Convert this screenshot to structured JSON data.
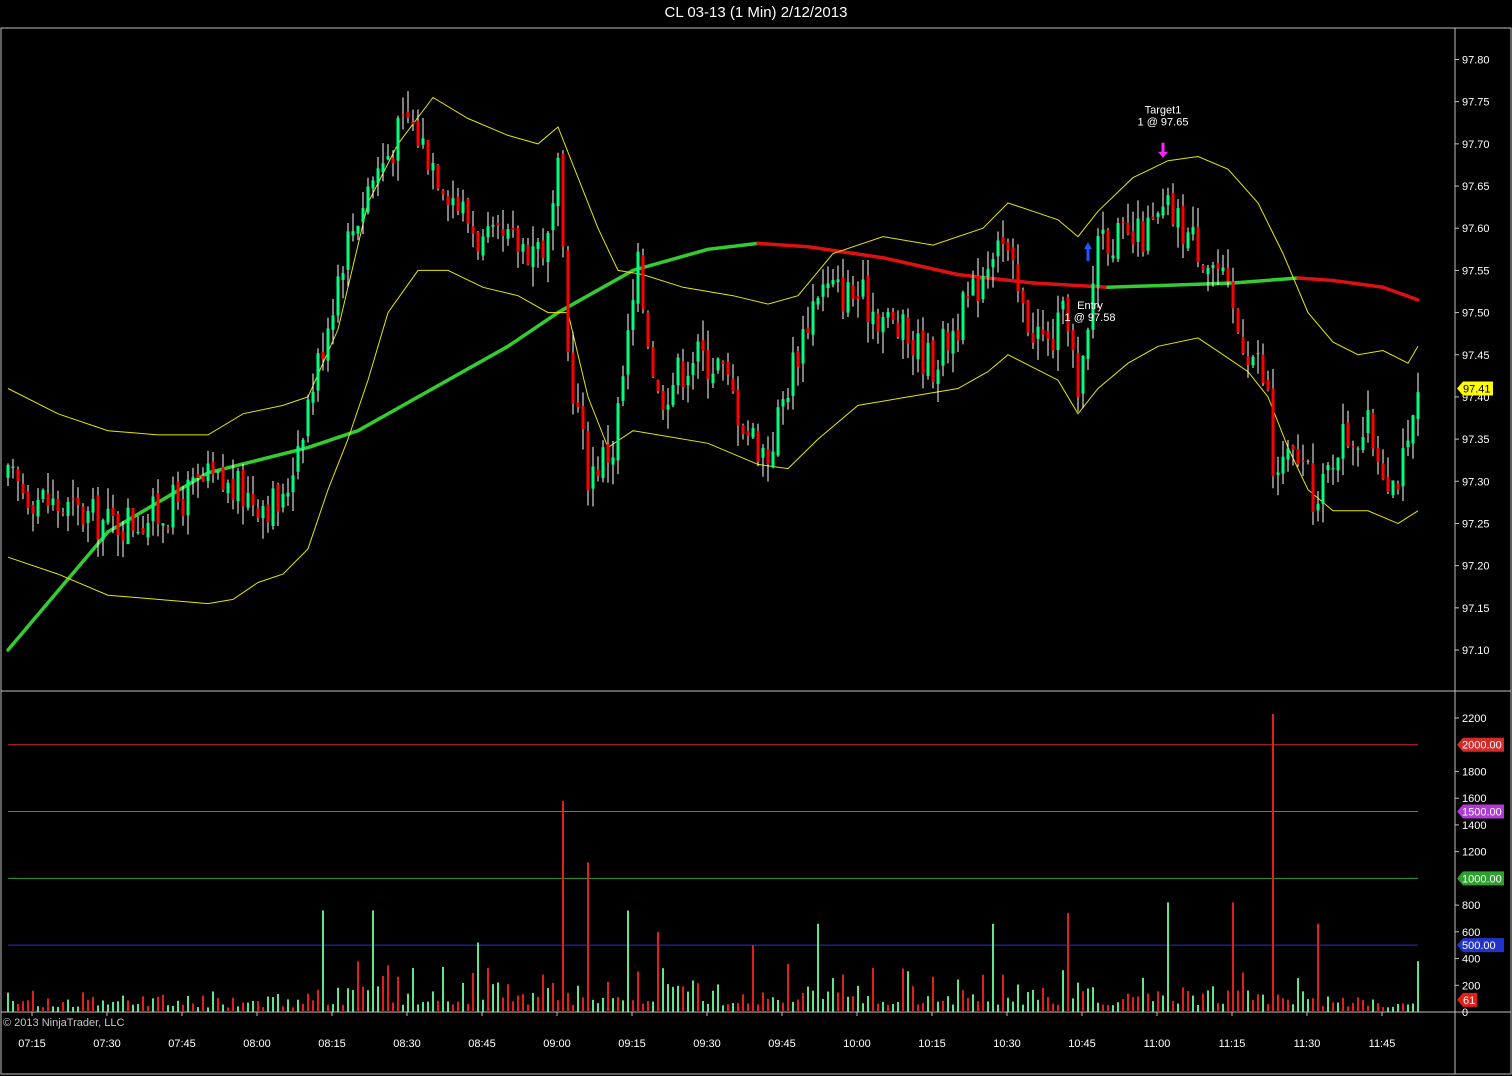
{
  "window": {
    "title": "CL 03-13 (1 Min)  2/12/2013"
  },
  "footer": {
    "copyright": "© 2013 NinjaTrader, LLC"
  },
  "colors": {
    "background": "#000000",
    "up_candle": "#00ff7f",
    "down_candle": "#ff0000",
    "wick": "#ffffff",
    "bollinger": "#e6e600",
    "ma_rising": "#33cc33",
    "ma_falling": "#dd1111",
    "volume_up": "#5fe68a",
    "volume_down": "#e0201a",
    "grid_border": "#c0c0c0"
  },
  "chart_data": [
    {
      "type": "candlestick",
      "panel": "price",
      "instrument": "CL 03-13",
      "interval": "1 Min",
      "date": "2/12/2013",
      "x_ticks": [
        "07:15",
        "07:30",
        "07:45",
        "08:00",
        "08:15",
        "08:30",
        "08:45",
        "09:00",
        "09:15",
        "09:30",
        "09:45",
        "10:00",
        "10:15",
        "10:30",
        "10:45",
        "11:00",
        "11:15",
        "11:30",
        "11:45"
      ],
      "y_ticks": [
        97.8,
        97.75,
        97.7,
        97.65,
        97.6,
        97.55,
        97.5,
        97.45,
        97.4,
        97.35,
        97.3,
        97.25,
        97.2,
        97.15,
        97.1
      ],
      "ylim": [
        97.05,
        97.83
      ],
      "last_price": "97.41",
      "anchors": [
        {
          "t": 0,
          "p": 97.3
        },
        {
          "t": 10,
          "p": 97.27
        },
        {
          "t": 20,
          "p": 97.25
        },
        {
          "t": 30,
          "p": 97.26
        },
        {
          "t": 40,
          "p": 97.3
        },
        {
          "t": 50,
          "p": 97.28
        },
        {
          "t": 55,
          "p": 97.27
        },
        {
          "t": 58,
          "p": 97.35
        },
        {
          "t": 62,
          "p": 97.44
        },
        {
          "t": 67,
          "p": 97.57
        },
        {
          "t": 72,
          "p": 97.65
        },
        {
          "t": 80,
          "p": 97.73
        },
        {
          "t": 88,
          "p": 97.65
        },
        {
          "t": 95,
          "p": 97.58
        },
        {
          "t": 103,
          "p": 97.58
        },
        {
          "t": 108,
          "p": 97.58
        },
        {
          "t": 110,
          "p": 97.66
        },
        {
          "t": 112,
          "p": 97.45
        },
        {
          "t": 116,
          "p": 97.31
        },
        {
          "t": 121,
          "p": 97.34
        },
        {
          "t": 126,
          "p": 97.55
        },
        {
          "t": 130,
          "p": 97.4
        },
        {
          "t": 137,
          "p": 97.45
        },
        {
          "t": 142,
          "p": 97.44
        },
        {
          "t": 148,
          "p": 97.36
        },
        {
          "t": 152,
          "p": 97.33
        },
        {
          "t": 157,
          "p": 97.44
        },
        {
          "t": 162,
          "p": 97.53
        },
        {
          "t": 170,
          "p": 97.52
        },
        {
          "t": 178,
          "p": 97.48
        },
        {
          "t": 185,
          "p": 97.44
        },
        {
          "t": 193,
          "p": 97.52
        },
        {
          "t": 198,
          "p": 97.6
        },
        {
          "t": 203,
          "p": 97.5
        },
        {
          "t": 208,
          "p": 97.46
        },
        {
          "t": 212,
          "p": 97.5
        },
        {
          "t": 214,
          "p": 97.39
        },
        {
          "t": 216,
          "p": 97.47
        },
        {
          "t": 218,
          "p": 97.6
        },
        {
          "t": 224,
          "p": 97.58
        },
        {
          "t": 229,
          "p": 97.6
        },
        {
          "t": 232,
          "p": 97.62
        },
        {
          "t": 238,
          "p": 97.58
        },
        {
          "t": 242,
          "p": 97.55
        },
        {
          "t": 246,
          "p": 97.48
        },
        {
          "t": 250,
          "p": 97.44
        },
        {
          "t": 252,
          "p": 97.4
        },
        {
          "t": 253,
          "p": 97.31
        },
        {
          "t": 258,
          "p": 97.33
        },
        {
          "t": 262,
          "p": 97.27
        },
        {
          "t": 266,
          "p": 97.35
        },
        {
          "t": 272,
          "p": 97.36
        },
        {
          "t": 277,
          "p": 97.3
        },
        {
          "t": 280,
          "p": 97.33
        },
        {
          "t": 282,
          "p": 97.4
        }
      ],
      "series": [
        {
          "name": "",
          "kind": "sma_slow",
          "points": [
            {
              "t": 0,
              "p": 97.1
            },
            {
              "t": 20,
              "p": 97.24
            },
            {
              "t": 40,
              "p": 97.31
            },
            {
              "t": 60,
              "p": 97.34
            },
            {
              "t": 70,
              "p": 97.36
            },
            {
              "t": 85,
              "p": 97.41
            },
            {
              "t": 100,
              "p": 97.46
            },
            {
              "t": 110,
              "p": 97.5
            },
            {
              "t": 125,
              "p": 97.55
            },
            {
              "t": 140,
              "p": 97.575
            },
            {
              "t": 150,
              "p": 97.582
            },
            {
              "t": 160,
              "p": 97.578
            },
            {
              "t": 175,
              "p": 97.565
            },
            {
              "t": 190,
              "p": 97.545
            },
            {
              "t": 205,
              "p": 97.535
            },
            {
              "t": 220,
              "p": 97.53
            },
            {
              "t": 230,
              "p": 97.532
            },
            {
              "t": 245,
              "p": 97.535
            },
            {
              "t": 258,
              "p": 97.541
            },
            {
              "t": 265,
              "p": 97.538
            },
            {
              "t": 275,
              "p": 97.53
            },
            {
              "t": 282,
              "p": 97.515
            }
          ]
        },
        {
          "name": "",
          "kind": "bollinger_upper",
          "points": [
            {
              "t": 0,
              "p": 97.41
            },
            {
              "t": 10,
              "p": 97.38
            },
            {
              "t": 20,
              "p": 97.36
            },
            {
              "t": 30,
              "p": 97.355
            },
            {
              "t": 40,
              "p": 97.355
            },
            {
              "t": 47,
              "p": 97.38
            },
            {
              "t": 55,
              "p": 97.39
            },
            {
              "t": 60,
              "p": 97.4
            },
            {
              "t": 66,
              "p": 97.48
            },
            {
              "t": 72,
              "p": 97.63
            },
            {
              "t": 78,
              "p": 97.7
            },
            {
              "t": 85,
              "p": 97.755
            },
            {
              "t": 92,
              "p": 97.73
            },
            {
              "t": 100,
              "p": 97.71
            },
            {
              "t": 106,
              "p": 97.7
            },
            {
              "t": 110,
              "p": 97.72
            },
            {
              "t": 114,
              "p": 97.66
            },
            {
              "t": 118,
              "p": 97.6
            },
            {
              "t": 122,
              "p": 97.55
            },
            {
              "t": 127,
              "p": 97.545
            },
            {
              "t": 135,
              "p": 97.53
            },
            {
              "t": 145,
              "p": 97.52
            },
            {
              "t": 152,
              "p": 97.51
            },
            {
              "t": 158,
              "p": 97.52
            },
            {
              "t": 165,
              "p": 97.57
            },
            {
              "t": 175,
              "p": 97.59
            },
            {
              "t": 185,
              "p": 97.58
            },
            {
              "t": 195,
              "p": 97.6
            },
            {
              "t": 200,
              "p": 97.63
            },
            {
              "t": 205,
              "p": 97.62
            },
            {
              "t": 210,
              "p": 97.61
            },
            {
              "t": 214,
              "p": 97.59
            },
            {
              "t": 218,
              "p": 97.62
            },
            {
              "t": 225,
              "p": 97.66
            },
            {
              "t": 232,
              "p": 97.68
            },
            {
              "t": 238,
              "p": 97.685
            },
            {
              "t": 244,
              "p": 97.67
            },
            {
              "t": 250,
              "p": 97.63
            },
            {
              "t": 255,
              "p": 97.57
            },
            {
              "t": 260,
              "p": 97.5
            },
            {
              "t": 265,
              "p": 97.465
            },
            {
              "t": 270,
              "p": 97.45
            },
            {
              "t": 275,
              "p": 97.455
            },
            {
              "t": 280,
              "p": 97.44
            },
            {
              "t": 282,
              "p": 97.46
            }
          ]
        },
        {
          "name": "",
          "kind": "bollinger_lower",
          "points": [
            {
              "t": 0,
              "p": 97.21
            },
            {
              "t": 10,
              "p": 97.19
            },
            {
              "t": 20,
              "p": 97.165
            },
            {
              "t": 30,
              "p": 97.16
            },
            {
              "t": 40,
              "p": 97.155
            },
            {
              "t": 45,
              "p": 97.16
            },
            {
              "t": 50,
              "p": 97.18
            },
            {
              "t": 55,
              "p": 97.19
            },
            {
              "t": 60,
              "p": 97.22
            },
            {
              "t": 64,
              "p": 97.29
            },
            {
              "t": 68,
              "p": 97.35
            },
            {
              "t": 72,
              "p": 97.42
            },
            {
              "t": 76,
              "p": 97.5
            },
            {
              "t": 82,
              "p": 97.55
            },
            {
              "t": 88,
              "p": 97.55
            },
            {
              "t": 95,
              "p": 97.53
            },
            {
              "t": 102,
              "p": 97.52
            },
            {
              "t": 108,
              "p": 97.5
            },
            {
              "t": 112,
              "p": 97.5
            },
            {
              "t": 116,
              "p": 97.4
            },
            {
              "t": 120,
              "p": 97.34
            },
            {
              "t": 125,
              "p": 97.36
            },
            {
              "t": 130,
              "p": 97.355
            },
            {
              "t": 140,
              "p": 97.345
            },
            {
              "t": 150,
              "p": 97.32
            },
            {
              "t": 156,
              "p": 97.315
            },
            {
              "t": 162,
              "p": 97.35
            },
            {
              "t": 170,
              "p": 97.39
            },
            {
              "t": 180,
              "p": 97.4
            },
            {
              "t": 190,
              "p": 97.41
            },
            {
              "t": 196,
              "p": 97.43
            },
            {
              "t": 200,
              "p": 97.45
            },
            {
              "t": 205,
              "p": 97.435
            },
            {
              "t": 210,
              "p": 97.42
            },
            {
              "t": 214,
              "p": 97.38
            },
            {
              "t": 218,
              "p": 97.41
            },
            {
              "t": 224,
              "p": 97.44
            },
            {
              "t": 230,
              "p": 97.46
            },
            {
              "t": 238,
              "p": 97.47
            },
            {
              "t": 243,
              "p": 97.45
            },
            {
              "t": 248,
              "p": 97.43
            },
            {
              "t": 252,
              "p": 97.4
            },
            {
              "t": 256,
              "p": 97.34
            },
            {
              "t": 260,
              "p": 97.29
            },
            {
              "t": 265,
              "p": 97.265
            },
            {
              "t": 272,
              "p": 97.265
            },
            {
              "t": 278,
              "p": 97.25
            },
            {
              "t": 282,
              "p": 97.265
            }
          ]
        }
      ],
      "annotations": [
        {
          "name": "entry",
          "label": "Entry",
          "detail": "1 @ 97.58",
          "t": 216,
          "p": 97.58,
          "arrow": "up",
          "color": "#2255ff"
        },
        {
          "name": "target",
          "label": "Target1",
          "detail": "1 @ 97.65",
          "t": 231,
          "p": 97.68,
          "arrow": "down",
          "color": "#ff22ff"
        }
      ]
    },
    {
      "type": "bar",
      "panel": "volume",
      "y_ticks": [
        2200,
        2000,
        1800,
        1600,
        1400,
        1200,
        1000,
        800,
        600,
        400,
        200,
        0
      ],
      "ylim": [
        0,
        2250
      ],
      "reference_lines": [
        {
          "value": 2000,
          "label": "2000.00",
          "color": "#d42a2a"
        },
        {
          "value": 1500,
          "label": "1500.00",
          "color": "#b03ad6"
        },
        {
          "value": 1000,
          "label": "1000.00",
          "color": "#2fa02f"
        },
        {
          "value": 500,
          "label": "500.00",
          "color": "#2233cc"
        }
      ],
      "last_volume": "61",
      "spikes": [
        {
          "t": 111,
          "v": 1580,
          "dir": "down"
        },
        {
          "t": 116,
          "v": 1120,
          "dir": "down"
        },
        {
          "t": 253,
          "v": 2230,
          "dir": "down"
        },
        {
          "t": 63,
          "v": 760,
          "dir": "up"
        },
        {
          "t": 73,
          "v": 760,
          "dir": "up"
        },
        {
          "t": 124,
          "v": 760,
          "dir": "up"
        },
        {
          "t": 232,
          "v": 820,
          "dir": "up"
        },
        {
          "t": 212,
          "v": 740,
          "dir": "down"
        },
        {
          "t": 245,
          "v": 820,
          "dir": "down"
        },
        {
          "t": 262,
          "v": 660,
          "dir": "down"
        },
        {
          "t": 162,
          "v": 660,
          "dir": "up"
        },
        {
          "t": 197,
          "v": 660,
          "dir": "up"
        },
        {
          "t": 94,
          "v": 520,
          "dir": "up"
        },
        {
          "t": 149,
          "v": 500,
          "dir": "down"
        },
        {
          "t": 130,
          "v": 600,
          "dir": "down"
        },
        {
          "t": 282,
          "v": 380,
          "dir": "up"
        },
        {
          "t": 282.6,
          "v": 61,
          "dir": "down"
        }
      ]
    }
  ]
}
